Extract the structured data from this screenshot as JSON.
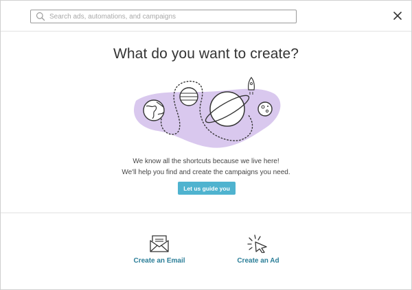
{
  "search": {
    "placeholder": "Search ads, automations, and campaigns"
  },
  "icons": {
    "search": "search-icon",
    "close": "close-icon",
    "email": "envelope-icon",
    "ad": "cursor-click-icon"
  },
  "main": {
    "title": "What do you want to create?",
    "description_line1": "We know all the shortcuts because we live here!",
    "description_line2": "We'll help you find and create the campaigns you need.",
    "guide_button": "Let us guide you"
  },
  "options": [
    {
      "label": "Create an Email"
    },
    {
      "label": "Create an Ad"
    }
  ],
  "colors": {
    "accent": "#4fb3cf",
    "link": "#2b7e98",
    "blob": "#d9c8ee"
  }
}
